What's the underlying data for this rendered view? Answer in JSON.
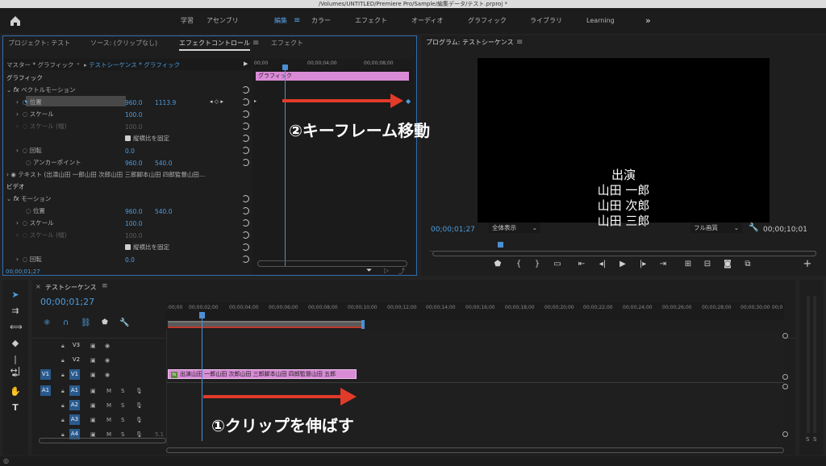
{
  "window": {
    "title": "/Volumes/UNTITLED/Premiere Pro/Sample/編集データ/テスト.prproj *"
  },
  "workspaces": [
    {
      "label": "学習"
    },
    {
      "label": "アセンブリ"
    },
    {
      "label": "編集",
      "active": true
    },
    {
      "label": "カラー"
    },
    {
      "label": "エフェクト"
    },
    {
      "label": "オーディオ"
    },
    {
      "label": "グラフィック"
    },
    {
      "label": "ライブラリ"
    },
    {
      "label": "Learning"
    }
  ],
  "left_panel": {
    "tabs": [
      "プロジェクト: テスト",
      "ソース: (クリップなし)",
      "エフェクトコントロール",
      "エフェクト"
    ],
    "master_label": "マスター * グラフィック",
    "sequence_label": "テストシーケンス * グラフィック",
    "ruler": [
      "00;00",
      "00;00;04;00",
      "00;00;08;00"
    ],
    "clip_label": "グラフィック",
    "section_graphic": "グラフィック",
    "vector_motion": "ベクトルモーション",
    "position_label": "位置",
    "position_x": "960.0",
    "position_y": "1113.9",
    "scale_label": "スケール",
    "scale_value": "100.0",
    "scale_w_label": "スケール (幅)",
    "scale_w_value": "100.0",
    "uniform_label": "縦横比を固定",
    "rotation_label": "回転",
    "rotation_value": "0.0",
    "anchor_label": "アンカーポイント",
    "anchor_x": "960.0",
    "anchor_y": "540.0",
    "text_layer": "テキスト (出演山田 一郎山田 次郎山田 三郎脚本山田 四郎監督山田…",
    "section_video": "ビデオ",
    "motion": "モーション",
    "m_position_label": "位置",
    "m_position_x": "960.0",
    "m_position_y": "540.0",
    "m_scale_label": "スケール",
    "m_scale_value": "100.0",
    "m_scale_w_label": "スケール (幅)",
    "m_scale_w_value": "100.0",
    "m_uniform_label": "縦横比を固定",
    "m_rotation_label": "回転",
    "m_rotation_value": "0.0",
    "timecode": "00;00;01;27"
  },
  "program": {
    "title": "プログラム: テストシーケンス",
    "credits": [
      "出演",
      "山田 一郎",
      "山田 次郎",
      "山田 三郎"
    ],
    "timecode": "00;00;01;27",
    "fit": "全体表示",
    "quality": "フル画質",
    "duration": "00;00;10;01"
  },
  "timeline": {
    "tab": "テストシーケンス",
    "timecode": "00;00;01;27",
    "ruler": [
      ":00;00",
      "00;00;02;00",
      "00;00;04;00",
      "00;00;06;00",
      "00;00;08;00",
      "00;00;10;00",
      "00;00;12;00",
      "00;00;14;00",
      "00;00;16;00",
      "00;00;18;00",
      "00;00;20;00",
      "00;00;22;00",
      "00;00;24;00",
      "00;00;26;00",
      "00;00;28;00",
      "00;00;30;00",
      "00;0"
    ],
    "video_tracks": [
      "V3",
      "V2",
      "V1"
    ],
    "audio_tracks": [
      "A1",
      "A2",
      "A3",
      "A4"
    ],
    "source_v": "V1",
    "source_a": "A1",
    "m_label": "M",
    "s_label": "S",
    "clip_text": "出演山田 一郎山田 次郎山田 三郎脚本山田 四郎監督山田 五郎",
    "clip_fx": "fx",
    "a4_extra": "5.1",
    "meter_labels": [
      "S",
      "S"
    ]
  },
  "annotations": {
    "step1": "①クリップを伸ばす",
    "step2": "②キーフレーム移動",
    "arrow_color": "#e23b2a"
  }
}
